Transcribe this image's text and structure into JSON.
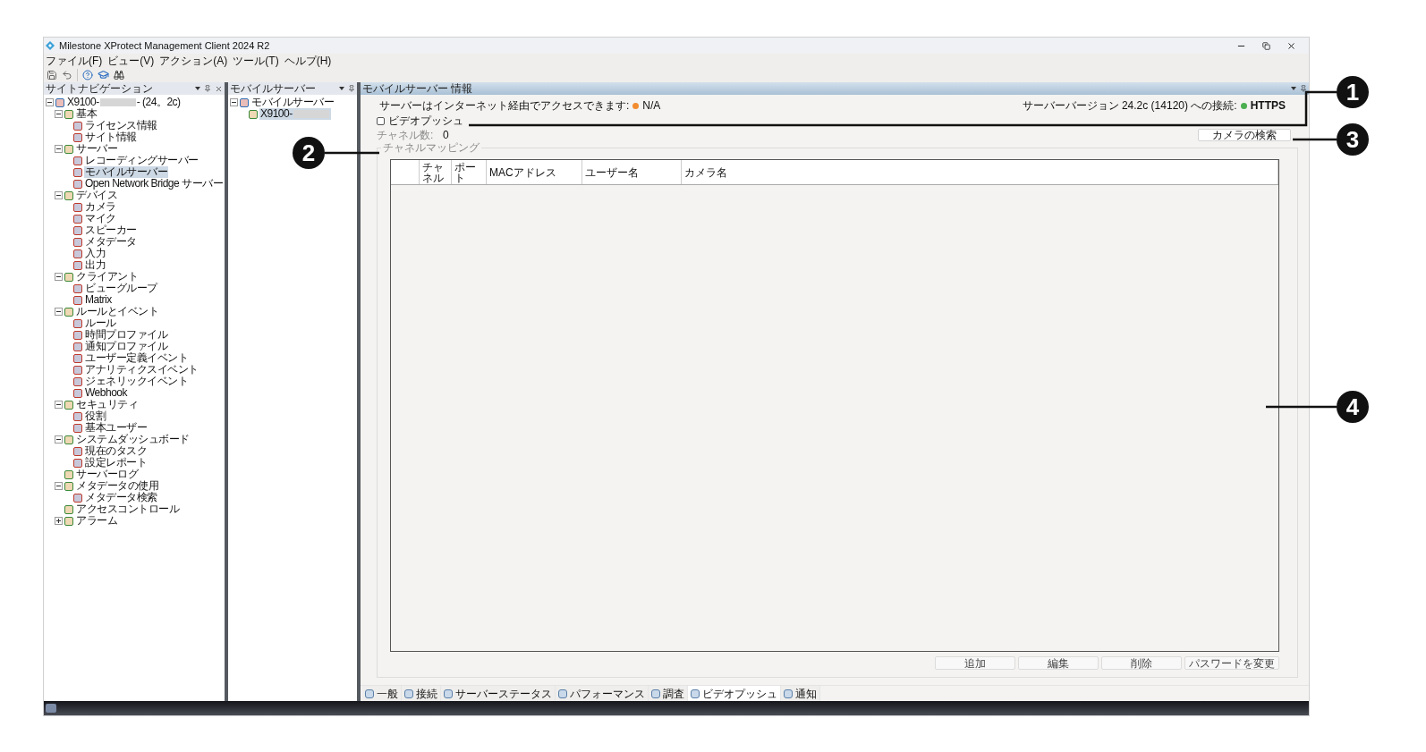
{
  "window": {
    "title": "Milestone XProtect Management Client 2024 R2"
  },
  "menu": [
    "ファイル(F)",
    "ビュー(V)",
    "アクション(A)",
    "ツール(T)",
    "ヘルプ(H)"
  ],
  "site_navigation": {
    "title": "サイトナビゲーション",
    "tree": [
      {
        "label": "X9100-",
        "suffix": "- (24。2c)",
        "redacted": true,
        "expanded": true,
        "selected": false,
        "children": [
          {
            "label": "基本",
            "expanded": true,
            "selected": false,
            "children": [
              {
                "label": "ライセンス情報",
                "selected": false
              },
              {
                "label": "サイト情報",
                "selected": false
              }
            ]
          },
          {
            "label": "サーバー",
            "expanded": true,
            "selected": false,
            "children": [
              {
                "label": "レコーディングサーバー",
                "selected": false
              },
              {
                "label": "モバイルサーバー",
                "selected": true
              },
              {
                "label": "Open Network Bridge サーバー",
                "selected": false
              }
            ]
          },
          {
            "label": "デバイス",
            "expanded": true,
            "selected": false,
            "children": [
              {
                "label": "カメラ",
                "selected": false
              },
              {
                "label": "マイク",
                "selected": false
              },
              {
                "label": "スピーカー",
                "selected": false
              },
              {
                "label": "メタデータ",
                "selected": false
              },
              {
                "label": "入力",
                "selected": false
              },
              {
                "label": "出力",
                "selected": false
              }
            ]
          },
          {
            "label": "クライアント",
            "expanded": true,
            "selected": false,
            "children": [
              {
                "label": "ビューグループ",
                "selected": false
              },
              {
                "label": "Matrix",
                "selected": false
              }
            ]
          },
          {
            "label": "ルールとイベント",
            "expanded": true,
            "selected": false,
            "children": [
              {
                "label": "ルール",
                "selected": false
              },
              {
                "label": "時間プロファイル",
                "selected": false
              },
              {
                "label": "通知プロファイル",
                "selected": false
              },
              {
                "label": "ユーザー定義イベント",
                "selected": false
              },
              {
                "label": "アナリティクスイベント",
                "selected": false
              },
              {
                "label": "ジェネリックイベント",
                "selected": false
              },
              {
                "label": "Webhook",
                "selected": false
              }
            ]
          },
          {
            "label": "セキュリティ",
            "expanded": true,
            "selected": false,
            "children": [
              {
                "label": "役割",
                "selected": false
              },
              {
                "label": "基本ユーザー",
                "selected": false
              }
            ]
          },
          {
            "label": "システムダッシュボード",
            "expanded": true,
            "selected": false,
            "children": [
              {
                "label": "現在のタスク",
                "selected": false
              },
              {
                "label": "設定レポート",
                "selected": false
              }
            ]
          },
          {
            "label": "サーバーログ",
            "selected": false
          },
          {
            "label": "メタデータの使用",
            "expanded": true,
            "selected": false,
            "children": [
              {
                "label": "メタデータ検索",
                "selected": false
              }
            ]
          },
          {
            "label": "アクセスコントロール",
            "selected": false
          },
          {
            "label": "アラーム",
            "expanded": false,
            "selected": false
          }
        ]
      }
    ]
  },
  "mobile_servers": {
    "title": "モバイルサーバー",
    "tree": [
      {
        "label": "モバイルサーバー",
        "expanded": true,
        "selected": false,
        "children": [
          {
            "label": "X9100-",
            "redacted": true,
            "selected": true
          }
        ]
      }
    ]
  },
  "info": {
    "title": "モバイルサーバー 情報",
    "internet_access": {
      "label": "サーバーはインターネット経由でアクセスできます:",
      "color": "#f28b30",
      "value": "N/A"
    },
    "connection": {
      "label": "サーバーバージョン 24.2c (14120) への接続:",
      "color": "#4caf50",
      "value": "HTTPS"
    },
    "video_push": {
      "label": "ビデオプッシュ",
      "checked": false
    },
    "channel_count": {
      "label": "チャネル数:",
      "value": "0",
      "disabled": true
    },
    "find_cameras_button": "カメラの検索",
    "channel_mapping": {
      "title": "チャネルマッピング",
      "disabled": true,
      "columns": [
        "チャネル",
        "ポート",
        "MACアドレス",
        "ユーザー名",
        "カメラ名"
      ]
    },
    "buttons": [
      "追加",
      "編集",
      "削除",
      "パスワードを変更"
    ],
    "tabs": [
      {
        "label": "一般",
        "selected": false
      },
      {
        "label": "接続",
        "selected": false
      },
      {
        "label": "サーバーステータス",
        "selected": false
      },
      {
        "label": "パフォーマンス",
        "selected": false
      },
      {
        "label": "調査",
        "selected": false
      },
      {
        "label": "ビデオプッシュ",
        "selected": true
      },
      {
        "label": "通知",
        "selected": false
      }
    ]
  },
  "callouts": [
    {
      "number": "1"
    },
    {
      "number": "2"
    },
    {
      "number": "3"
    },
    {
      "number": "4"
    }
  ]
}
